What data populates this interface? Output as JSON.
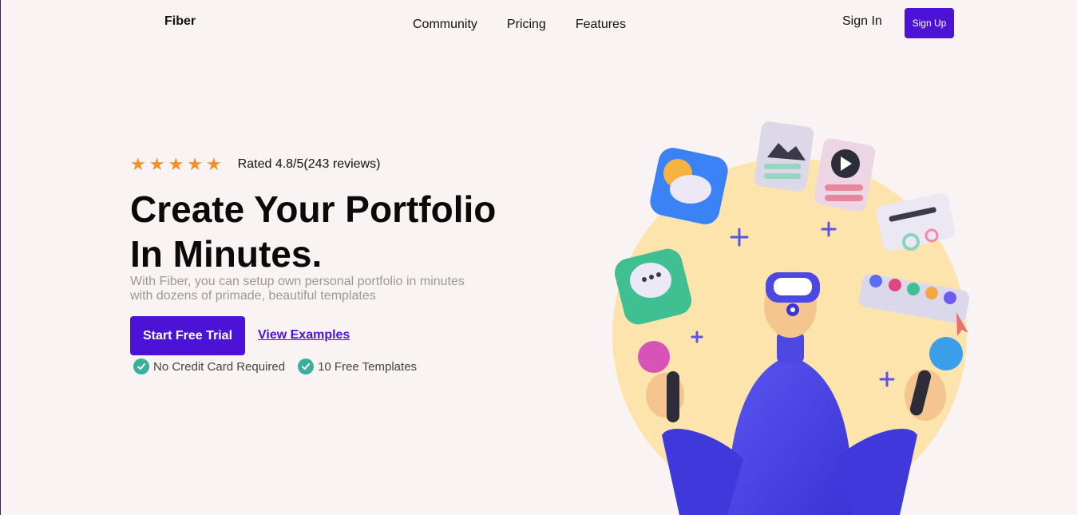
{
  "brand": {
    "name": "Fiber"
  },
  "nav": {
    "items": [
      "Community",
      "Pricing",
      "Features"
    ]
  },
  "auth": {
    "signin_label": "Sign In",
    "signup_label": "Sign Up"
  },
  "hero": {
    "stars": 5,
    "rating_text": "Rated 4.8/5(243 reviews)",
    "headline_line1": "Create Your Portfolio",
    "headline_line2": "In Minutes.",
    "subtext": "With Fiber, you can setup own personal portfolio in minutes with dozens of primade, beautiful templates",
    "cta_label": "Start Free Trial",
    "secondary_label": "View Examples",
    "perks": [
      "No Credit Card Required",
      "10 Free Templates"
    ]
  },
  "colors": {
    "accent": "#4c12d6",
    "star": "#f2902f",
    "check": "#3ab09a",
    "background": "#f9f3f3"
  }
}
